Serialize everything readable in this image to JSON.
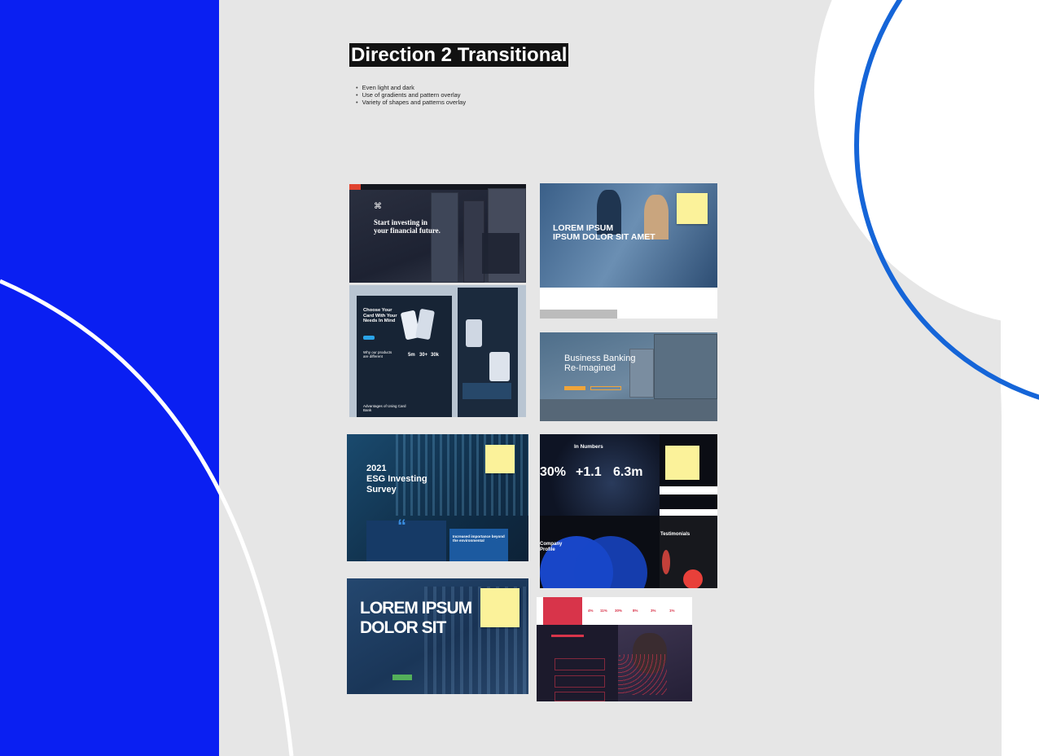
{
  "heading": {
    "title": "Direction 2 Transitional",
    "bullets": [
      "Even light and dark",
      "Use of gradients and pattern overlay",
      "Variety of shapes and patterns overlay"
    ]
  },
  "colors": {
    "blue_panel": "#0a1ff2",
    "arc_blue": "#1565d8",
    "canvas_gray": "#e6e6e6",
    "title_bg": "#121212"
  },
  "thumbnails": [
    {
      "id": "start-investing",
      "heading": "Start investing in your financial future."
    },
    {
      "id": "lorem-ipsum-banner",
      "heading_line1": "LOREM IPSUM",
      "heading_line2": "IPSUM DOLOR SIT AMET"
    },
    {
      "id": "choose-your-card",
      "heading": "Choose Your Card With Your Needs In Mind",
      "subheading": "Why our products are different",
      "stats": [
        "5m",
        "30+",
        "30k"
      ],
      "footer": "Advantages of Using Card Bank"
    },
    {
      "id": "business-banking",
      "heading_line1": "Business Banking",
      "heading_line2": "Re-Imagined"
    },
    {
      "id": "esg-survey",
      "heading_line1": "2021",
      "heading_line2": "ESG Investing",
      "heading_line3": "Survey",
      "quote_mark": "“",
      "side_heading": "Increased importance beyond the environmental"
    },
    {
      "id": "in-numbers",
      "heading": "In Numbers",
      "stats": [
        "30%",
        "+1.1",
        "6.3m"
      ],
      "label_company": "Company Profile",
      "label_testimonials": "Testimonials"
    },
    {
      "id": "lorem-ipsum-dolor",
      "heading_line1": "LOREM IPSUM",
      "heading_line2": "DOLOR SIT"
    },
    {
      "id": "red-dark-page",
      "stats": [
        "4%",
        "11%",
        "30%",
        "8%",
        "3%",
        "1%"
      ]
    }
  ]
}
